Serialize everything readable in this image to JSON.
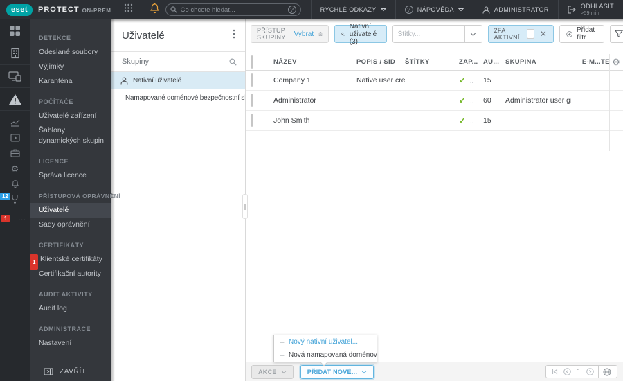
{
  "topbar": {
    "brand": {
      "logo": "eset",
      "product": "PROTECT",
      "edition": "ON-PREM"
    },
    "search": {
      "placeholder": "Co chcete hledat..."
    },
    "quick_links": "RYCHLÉ ODKAZY",
    "help": "NÁPOVĚDA",
    "user": "ADMINISTRATOR",
    "logout": {
      "label": "ODHLÁSIT",
      "timeout": ">59 min"
    }
  },
  "rail": {
    "icons": [
      "dashboard",
      "company",
      "computers",
      "detections",
      "reports",
      "tasks",
      "installers",
      "policies",
      "notifications",
      "status-overview"
    ],
    "status_badge": "12",
    "more_badge": "1"
  },
  "sidebar": {
    "sections": [
      {
        "title": "DETEKCE",
        "items": [
          {
            "label": "Odeslané soubory"
          },
          {
            "label": "Výjimky"
          },
          {
            "label": "Karanténa"
          }
        ]
      },
      {
        "title": "POČÍTAČE",
        "items": [
          {
            "label": "Uživatelé zařízení"
          },
          {
            "label": "Šablony dynamických skupin"
          }
        ]
      },
      {
        "title": "LICENCE",
        "items": [
          {
            "label": "Správa licence"
          }
        ]
      },
      {
        "title": "PŘÍSTUPOVÁ OPRÁVNĚNÍ",
        "items": [
          {
            "label": "Uživatelé"
          },
          {
            "label": "Sady oprávnění"
          }
        ]
      },
      {
        "title": "CERTIFIKÁTY",
        "items": [
          {
            "label": "Klientské certifikáty",
            "badge": "1"
          },
          {
            "label": "Certifikační autority"
          }
        ]
      },
      {
        "title": "AUDIT AKTIVITY",
        "items": [
          {
            "label": "Audit log"
          }
        ]
      },
      {
        "title": "ADMINISTRACE",
        "items": [
          {
            "label": "Nastavení"
          }
        ]
      }
    ],
    "collapse_label": "ZAVŘÍT"
  },
  "groups_panel": {
    "title": "Uživatelé",
    "search_label": "Skupiny",
    "items": [
      {
        "label": "Nativní uživatelé",
        "icon": "user"
      },
      {
        "label": "Namapované doménové bezpečnostní skupiny",
        "icon": "user-group"
      }
    ]
  },
  "filters": {
    "access_group_label": "PŘÍSTUP SKUPINY",
    "access_group_action": "Vybrat",
    "group_chip": "Nativní uživatelé (3)",
    "tags_placeholder": "Štítky...",
    "twofa_chip": "2FA AKTIVNÍ",
    "add_filter": "Přidat filtr"
  },
  "table": {
    "columns": [
      "NÁZEV",
      "POPIS / SID",
      "ŠTÍTKY",
      "ZAP...",
      "AU...",
      "SKUPINA",
      "E-M...",
      "TE"
    ],
    "rows": [
      {
        "name": "Company 1",
        "desc": "Native user cre...",
        "tags": "",
        "enabled_more": "...",
        "au": "15",
        "group": ""
      },
      {
        "name": "Administrator",
        "desc": "",
        "tags": "",
        "enabled_more": "...",
        "au": "60",
        "group": "Administrator user group"
      },
      {
        "name": "John Smith",
        "desc": "",
        "tags": "",
        "enabled_more": "...",
        "au": "15",
        "group": ""
      }
    ]
  },
  "popup": {
    "items": [
      {
        "label": "Nový nativní uživatel..."
      },
      {
        "label": "Nová namapovaná doménová be..."
      }
    ]
  },
  "footer": {
    "actions_label": "AKCE",
    "add_new_label": "PŘIDAT NOVÉ...",
    "page": "1"
  },
  "colors": {
    "brand_teal": "#00a3a5",
    "accent_blue": "#45a4d8",
    "selection_blue_bg": "#d7ecf8",
    "check_green": "#76b82a",
    "notification_amber": "#e9a23b",
    "badge_red": "#d9342b",
    "badge_blue": "#2e9fe6",
    "chrome_dark": "#2c2f34"
  }
}
